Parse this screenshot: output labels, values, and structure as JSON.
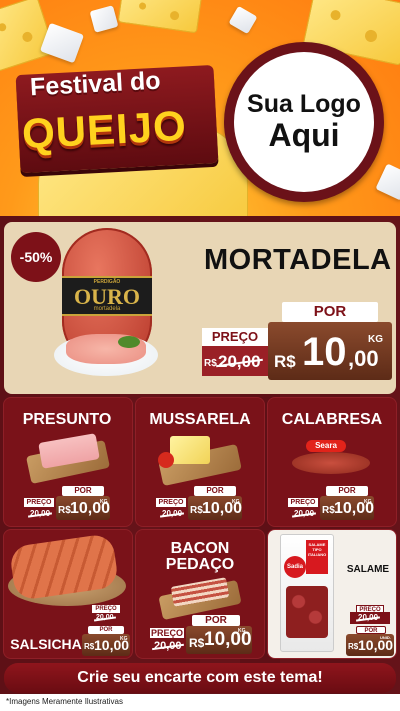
{
  "header": {
    "title_line1": "Festival do",
    "title_line2": "QUEIJO"
  },
  "logo": {
    "line1": "Sua Logo",
    "line2": "Aqui"
  },
  "featured": {
    "discount": "-50%",
    "brand_top": "PERDIGÃO",
    "brand_main": "OURO",
    "brand_sub": "mortadela",
    "name": "MORTADELA",
    "por": "POR",
    "preco": "PREÇO",
    "old_price": "20,00",
    "currency": "R$",
    "price_int": "10",
    "price_dec": ",00",
    "unit": "KG"
  },
  "products": [
    {
      "name": "PRESUNTO",
      "preco": "PREÇO",
      "por": "POR",
      "old_price": "20,00",
      "currency": "R$",
      "price": "10,00",
      "unit": "KG"
    },
    {
      "name": "MUSSARELA",
      "preco": "PREÇO",
      "por": "POR",
      "old_price": "20,00",
      "currency": "R$",
      "price": "10,00",
      "unit": "KG"
    },
    {
      "name": "CALABRESA",
      "brand": "Seara",
      "preco": "PREÇO",
      "por": "POR",
      "old_price": "20,00",
      "currency": "R$",
      "price": "10,00",
      "unit": "KG"
    },
    {
      "name": "SALSICHA",
      "preco": "PREÇO",
      "por": "POR",
      "old_price": "20,00",
      "currency": "R$",
      "price": "10,00",
      "unit": "KG"
    },
    {
      "name_line1": "BACON",
      "name_line2": "PEDAÇO",
      "preco": "PREÇO",
      "por": "POR",
      "old_price": "20,00",
      "currency": "R$",
      "price": "10,00",
      "unit": "KG"
    },
    {
      "name": "SALAME",
      "brand": "Sadia",
      "pack_label": "SALAME TIPO ITALIANO",
      "preco": "PREÇO",
      "por": "POR",
      "old_price": "20,00",
      "currency": "R$",
      "price": "10,00",
      "unit": "UNID."
    }
  ],
  "cta": "Crie seu encarte com este tema!",
  "footnote": "*Imagens Meramente Ilustrativas",
  "colors": {
    "brand_red": "#7d1118",
    "board": "#5e1016",
    "hero_orange": "#ff8a15",
    "title_yellow": "#ffd21e",
    "featured_bg": "#e8d6b5"
  }
}
